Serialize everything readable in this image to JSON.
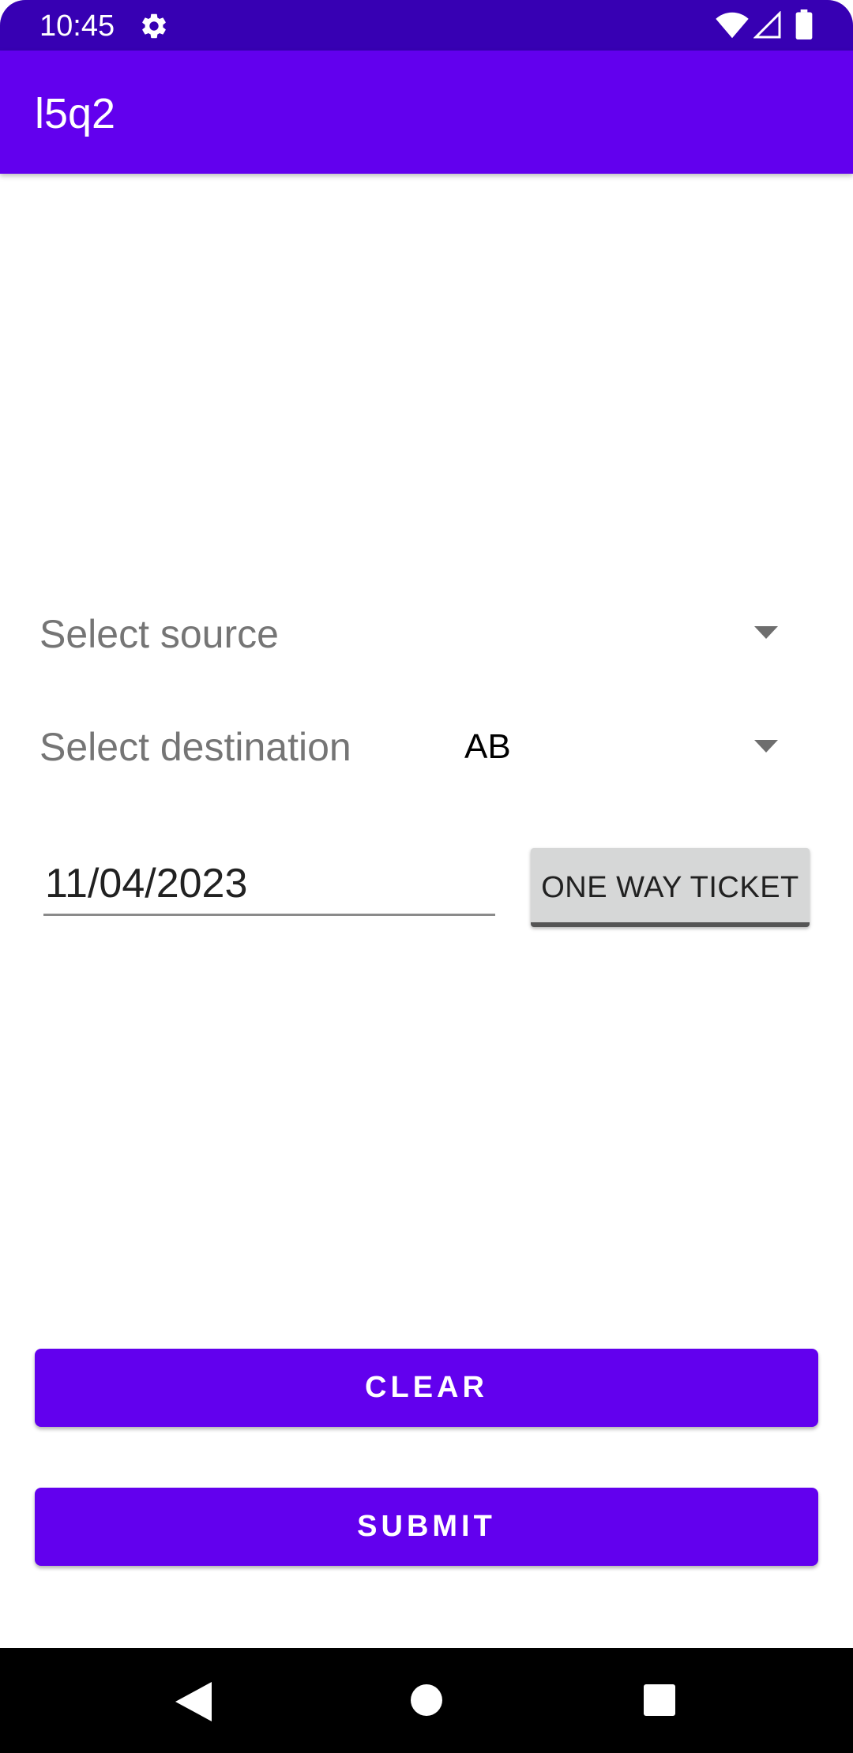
{
  "status_bar": {
    "time": "10:45",
    "icons": [
      "settings-gear-icon",
      "wifi-icon",
      "cell-signal-icon",
      "battery-icon"
    ]
  },
  "app_bar": {
    "title": "l5q2"
  },
  "form": {
    "source_label": "Select source",
    "source_value": "",
    "destination_label": "Select destination",
    "destination_value": "AB",
    "date_value": "11/04/2023",
    "ticket_toggle_label": "ONE WAY TICKET"
  },
  "actions": {
    "clear_label": "CLEAR",
    "submit_label": "SUBMIT"
  },
  "nav_bar": {
    "icons": [
      "back-icon",
      "home-icon",
      "recents-icon"
    ]
  },
  "colors": {
    "primary": "#6200ee",
    "primary_dark": "#3700b3",
    "label_gray": "#757575",
    "toggle_bg": "#d6d7d7"
  }
}
